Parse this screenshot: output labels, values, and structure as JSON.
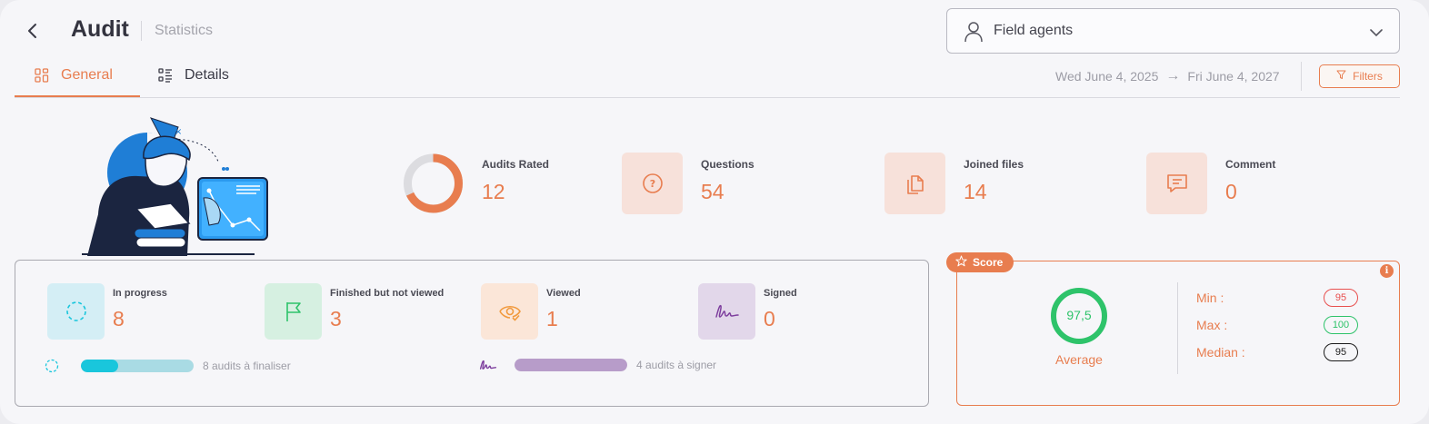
{
  "header": {
    "title": "Audit",
    "subtitle": "Statistics",
    "agent_select": {
      "value": "Field agents",
      "icon": "person-icon"
    }
  },
  "tabs": [
    {
      "label": "General",
      "icon": "grid-icon",
      "active": true
    },
    {
      "label": "Details",
      "icon": "list-icon",
      "active": false
    }
  ],
  "date_range": {
    "start": "Wed June 4, 2025",
    "arrow": "→",
    "end": "Fri June 4, 2027"
  },
  "filters_label": "Filters",
  "stats": [
    {
      "label": "Audits Rated",
      "value": "12",
      "icon": "donut-chart-icon",
      "ring_fraction": 0.68
    },
    {
      "label": "Questions",
      "value": "54",
      "icon": "question-icon"
    },
    {
      "label": "Joined files",
      "value": "14",
      "icon": "files-icon"
    },
    {
      "label": "Comment",
      "value": "0",
      "icon": "comment-icon"
    }
  ],
  "progress": {
    "kpis": [
      {
        "label": "In progress",
        "value": "8",
        "icon": "dashed-circle-icon",
        "color": "#d4eef5"
      },
      {
        "label": "Finished but not viewed",
        "value": "3",
        "icon": "flag-icon",
        "color": "#d6f0e1"
      },
      {
        "label": "Viewed",
        "value": "1",
        "icon": "eye-check-icon",
        "color": "#fbe6d8"
      },
      {
        "label": "Signed",
        "value": "0",
        "icon": "signature-icon",
        "color": "#e2d7ea"
      }
    ],
    "finalize": {
      "text": "8 audits à finaliser",
      "done_fraction": 0.33,
      "pending_fraction": 0.67,
      "colors": [
        "#19c6dc",
        "#a9dbe4"
      ]
    },
    "sign": {
      "text": "4 audits à signer",
      "fraction": 1.0,
      "color": "#b79cc9"
    }
  },
  "score": {
    "tag": "Score",
    "average": "97,5",
    "average_label": "Average",
    "min_label": "Min :",
    "min": "95",
    "max_label": "Max :",
    "max": "100",
    "median_label": "Median :",
    "median": "95",
    "colors": {
      "accent": "#e87d4f",
      "green": "#2ec36a",
      "red": "#e8504f"
    }
  }
}
